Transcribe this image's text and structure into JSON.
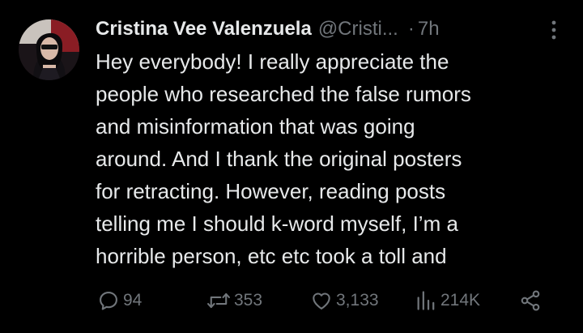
{
  "author": {
    "display_name": "Cristina Vee Valenzuela",
    "handle": "@Cristi...",
    "separator": "·",
    "time": "7h"
  },
  "tweet": {
    "lines": [
      "Hey everybody! I really appreciate the",
      "people who researched the false rumors",
      "and misinformation that was going",
      "around. And I thank the original posters",
      "for retracting. However, reading posts",
      "telling me I should k-word myself, I’m a",
      "horrible person, etc etc took a toll and"
    ]
  },
  "actions": {
    "replies": "94",
    "reposts": "353",
    "likes": "3,133",
    "views": "214K"
  },
  "colors": {
    "background": "#000000",
    "text_primary": "#e7e9ea",
    "text_secondary": "#71767b"
  },
  "icons": {
    "avatar": "avatar",
    "more": "more-vertical-icon",
    "reply": "reply-icon",
    "repost": "repost-icon",
    "like": "like-icon",
    "views": "views-icon",
    "share": "share-icon"
  }
}
